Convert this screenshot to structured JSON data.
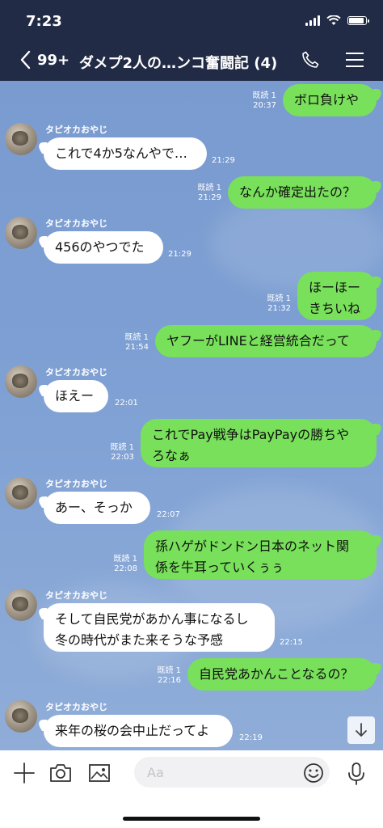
{
  "status": {
    "time": "7:23"
  },
  "header": {
    "unread_count": "99+",
    "title": "ダメプ2人の…ンコ奮闘記 (4)"
  },
  "messages": [
    {
      "side": "me",
      "text": "ボロ負けや",
      "read": "既読 1",
      "time": "20:37"
    },
    {
      "side": "them",
      "sender": "タピオカおやじ",
      "text": "これで4か5なんやで…",
      "time": "21:29"
    },
    {
      "side": "me",
      "text": "なんか確定出たの？",
      "read": "既読 1",
      "time": "21:29"
    },
    {
      "side": "them",
      "sender": "タピオカおやじ",
      "text": "456のやつでた",
      "time": "21:29"
    },
    {
      "side": "me",
      "text_lines": [
        "ほーほー",
        "きちいね"
      ],
      "read": "既読 1",
      "time": "21:32"
    },
    {
      "side": "me",
      "text": "ヤフーがLINEと経営統合だって",
      "read": "既読 1",
      "time": "21:54"
    },
    {
      "side": "them",
      "sender": "タピオカおやじ",
      "text": "ほえー",
      "time": "22:01"
    },
    {
      "side": "me",
      "text_lines": [
        "これでPay戦争はPayPayの勝ちや",
        "ろなぁ"
      ],
      "read": "既読 1",
      "time": "22:03"
    },
    {
      "side": "them",
      "sender": "タピオカおやじ",
      "text": "あー、そっか",
      "time": "22:07"
    },
    {
      "side": "me",
      "text_lines": [
        "孫ハゲがドンドン日本のネット関",
        "係を牛耳っていくぅぅ"
      ],
      "read": "既読 1",
      "time": "22:08"
    },
    {
      "side": "them",
      "sender": "タピオカおやじ",
      "text_lines": [
        "そして自民党があかん事になるし",
        "冬の時代がまた来そうな予感"
      ],
      "time": "22:15"
    },
    {
      "side": "me",
      "text": "自民党あかんことなるの？",
      "read": "既読 1",
      "time": "22:16"
    },
    {
      "side": "them",
      "sender": "タピオカおやじ",
      "text": "来年の桜の会中止だってよ",
      "time": "22:19"
    }
  ],
  "input": {
    "placeholder": "Aa"
  },
  "icons": {
    "back": "chevron-left-icon",
    "phone": "phone-icon",
    "menu": "hamburger-menu-icon",
    "add": "plus-icon",
    "camera": "camera-icon",
    "image": "image-icon",
    "emoji": "emoji-icon",
    "mic": "microphone-icon",
    "scroll": "arrow-down-icon"
  },
  "colors": {
    "header_bg": "#222b45",
    "my_bubble": "#78e05a",
    "their_bubble": "#ffffff",
    "chat_bg": "#7d9fd3"
  }
}
